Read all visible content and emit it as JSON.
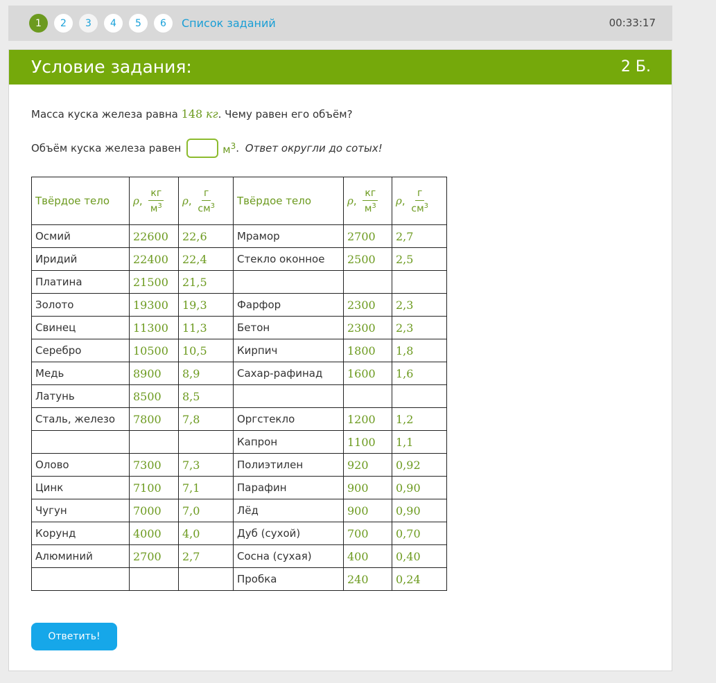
{
  "topbar": {
    "steps": [
      "1",
      "2",
      "3",
      "4",
      "5",
      "6"
    ],
    "task_list": "Список заданий",
    "timer": "00:33:17"
  },
  "header": {
    "title": "Условие задания:",
    "points": "2 Б."
  },
  "question": {
    "part1": "Масса куска железа равна ",
    "mass_value": "148",
    "mass_unit": "кг",
    "part2": ". Чему равен его объём?"
  },
  "answer": {
    "label": "Объём куска железа равен",
    "unit": "м",
    "unit_power": "3",
    "hint": "Ответ округли до сотых!",
    "value": ""
  },
  "table": {
    "headers": {
      "solid": "Твёрдое тело",
      "rho": "ρ",
      "kg": "кг",
      "m": "м",
      "g": "г",
      "cm": "см",
      "pow": "3"
    },
    "rows": [
      [
        "Осмий",
        "22600",
        "22,6",
        "Мрамор",
        "2700",
        "2,7"
      ],
      [
        "Иридий",
        "22400",
        "22,4",
        "Стекло оконное",
        "2500",
        "2,5"
      ],
      [
        "Платина",
        "21500",
        "21,5",
        "",
        "",
        ""
      ],
      [
        "Золото",
        "19300",
        "19,3",
        "Фарфор",
        "2300",
        "2,3"
      ],
      [
        "Свинец",
        "11300",
        "11,3",
        "Бетон",
        "2300",
        "2,3"
      ],
      [
        "Серебро",
        "10500",
        "10,5",
        "Кирпич",
        "1800",
        "1,8"
      ],
      [
        "Медь",
        "8900",
        "8,9",
        "Сахар-рафинад",
        "1600",
        "1,6"
      ],
      [
        "Латунь",
        "8500",
        "8,5",
        "",
        "",
        ""
      ],
      [
        "Сталь, железо",
        "7800",
        "7,8",
        "Оргстекло",
        "1200",
        "1,2"
      ],
      [
        "",
        "",
        "",
        "Капрон",
        "1100",
        "1,1"
      ],
      [
        "Олово",
        "7300",
        "7,3",
        "Полиэтилен",
        "920",
        "0,92"
      ],
      [
        "Цинк",
        "7100",
        "7,1",
        "Парафин",
        "900",
        "0,90"
      ],
      [
        "Чугун",
        "7000",
        "7,0",
        "Лёд",
        "900",
        "0,90"
      ],
      [
        "Корунд",
        "4000",
        "4,0",
        "Дуб (сухой)",
        "700",
        "0,70"
      ],
      [
        "Алюминий",
        "2700",
        "2,7",
        "Сосна (сухая)",
        "400",
        "0,40"
      ],
      [
        "",
        "",
        "",
        "Пробка",
        "240",
        "0,24"
      ]
    ]
  },
  "submit_label": "Ответить!"
}
